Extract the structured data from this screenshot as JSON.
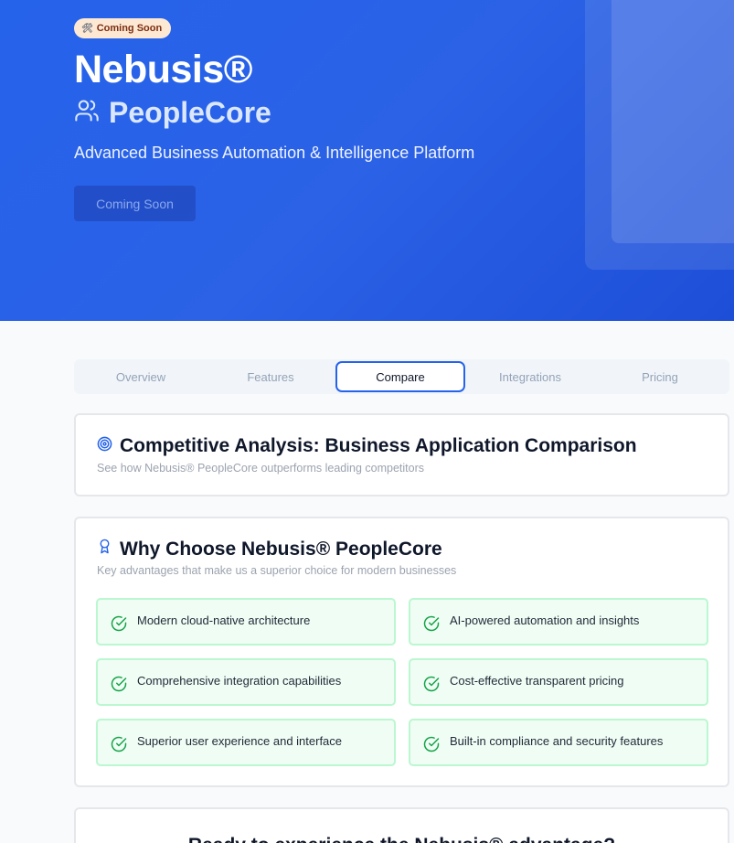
{
  "hero": {
    "badge": {
      "icon": "hammer-wrench-icon",
      "label": "Coming Soon"
    },
    "brand": "Nebusis®",
    "product": {
      "icon": "users-icon",
      "name": "PeopleCore"
    },
    "tagline": "Advanced Business Automation & Intelligence Platform",
    "cta_label": "Coming Soon"
  },
  "tabs": [
    {
      "label": "Overview",
      "active": false
    },
    {
      "label": "Features",
      "active": false
    },
    {
      "label": "Compare",
      "active": true
    },
    {
      "label": "Integrations",
      "active": false
    },
    {
      "label": "Pricing",
      "active": false
    }
  ],
  "competitive": {
    "icon": "target-icon",
    "title": "Competitive Analysis: Business Application Comparison",
    "subtitle": "See how Nebusis® PeopleCore outperforms leading competitors"
  },
  "why": {
    "icon": "award-icon",
    "title": "Why Choose Nebusis® PeopleCore",
    "subtitle": "Key advantages that make us a superior choice for modern businesses",
    "items": [
      "Modern cloud-native architecture",
      "AI-powered automation and insights",
      "Comprehensive integration capabilities",
      "Cost-effective transparent pricing",
      "Superior user experience and interface",
      "Built-in compliance and security features"
    ]
  },
  "cta_section": {
    "title": "Ready to experience the Nebusis® advantage?"
  },
  "colors": {
    "hero_blue": "#2563eb",
    "accent": "#2563eb",
    "success_bg": "#f0fdf4",
    "success_border": "#bbf7d0",
    "success_icon": "#16a34a"
  }
}
